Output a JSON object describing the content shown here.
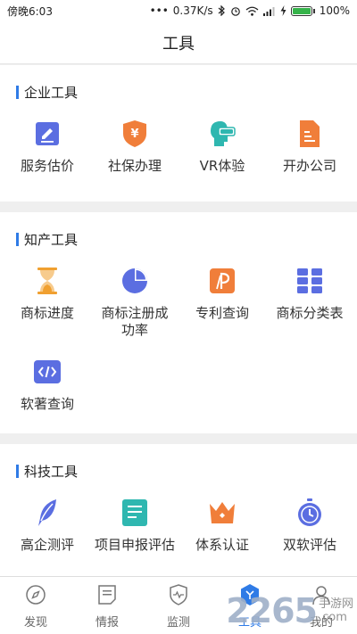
{
  "status": {
    "time": "傍晚6:03",
    "dots": "•••",
    "speed": "0.37K/s",
    "battery": "100%"
  },
  "header": {
    "title": "工具"
  },
  "sections": [
    {
      "title": "企业工具",
      "items": [
        {
          "label": "服务估价",
          "icon": "pen-note-icon",
          "color": "#5b6ee1"
        },
        {
          "label": "社保办理",
          "icon": "yen-shield-icon",
          "color": "#f07e3a"
        },
        {
          "label": "VR体验",
          "icon": "vr-head-icon",
          "color": "#2fb7b0"
        },
        {
          "label": "开办公司",
          "icon": "company-doc-icon",
          "color": "#f07e3a"
        }
      ]
    },
    {
      "title": "知产工具",
      "items": [
        {
          "label": "商标进度",
          "icon": "hourglass-icon",
          "color": "#f0a030"
        },
        {
          "label": "商标注册成功率",
          "icon": "pie-chart-icon",
          "color": "#5b6ee1"
        },
        {
          "label": "专利查询",
          "icon": "patent-icon",
          "color": "#f07e3a"
        },
        {
          "label": "商标分类表",
          "icon": "grid-table-icon",
          "color": "#5b6ee1"
        },
        {
          "label": "软著查询",
          "icon": "code-icon",
          "color": "#5b6ee1"
        }
      ]
    },
    {
      "title": "科技工具",
      "items": [
        {
          "label": "高企测评",
          "icon": "feather-icon",
          "color": "#5b6ee1"
        },
        {
          "label": "项目申报评估",
          "icon": "doc-lines-icon",
          "color": "#2fb7b0"
        },
        {
          "label": "体系认证",
          "icon": "crown-icon",
          "color": "#f07e3a"
        },
        {
          "label": "双软评估",
          "icon": "stopwatch-icon",
          "color": "#5b6ee1"
        }
      ]
    }
  ],
  "tabs": [
    {
      "label": "发现",
      "icon": "compass-icon"
    },
    {
      "label": "情报",
      "icon": "news-icon"
    },
    {
      "label": "监测",
      "icon": "monitor-shield-icon"
    },
    {
      "label": "工具",
      "icon": "tools-hex-icon"
    },
    {
      "label": "我的",
      "icon": "user-icon"
    }
  ],
  "active_tab": "工具",
  "watermark": {
    "big": "2265",
    "small": "手游网",
    "domain": ".com"
  },
  "colors": {
    "accent": "#2f7be6",
    "indigo": "#5b6ee1",
    "orange": "#f07e3a",
    "teal": "#2fb7b0"
  }
}
